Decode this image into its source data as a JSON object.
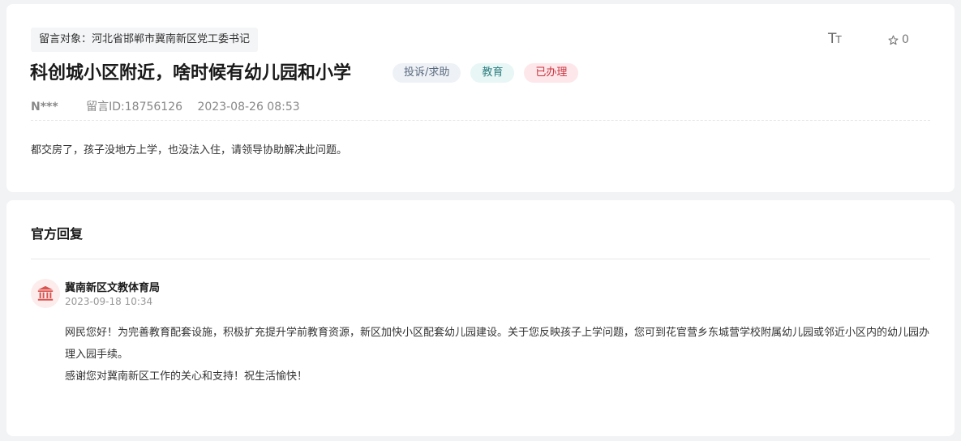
{
  "message": {
    "target": "留言对象：河北省邯郸市冀南新区党工委书记",
    "title": "科创城小区附近，啥时候有幼儿园和小学",
    "tags": [
      "投诉/求助",
      "教育",
      "已办理"
    ],
    "author": "N***",
    "message_id": "留言ID:18756126",
    "datetime": "2023-08-26 08:53",
    "content": "都交房了，孩子没地方上学，也没法入住，请领导协助解决此问题。",
    "font_size_label_big": "T",
    "font_size_label_small": "T",
    "star_count": "0"
  },
  "reply": {
    "heading": "官方回复",
    "org_name": "冀南新区文教体育局",
    "datetime": "2023-09-18 10:34",
    "paragraphs": [
      "网民您好！为完善教育配套设施，积极扩充提升学前教育资源，新区加快小区配套幼儿园建设。关于您反映孩子上学问题，您可到花官营乡东城营学校附属幼儿园或邻近小区内的幼儿园办理入园手续。",
      "感谢您对冀南新区工作的关心和支持！祝生活愉快！"
    ]
  },
  "colors": {
    "page_bg": "#f2f3f5",
    "tag_red": "#c8333e",
    "tag_teal": "#2f7f80",
    "avatar_bg": "#fdecec",
    "avatar_icon": "#d9534f"
  },
  "icons": {
    "font_size": "font-size-icon",
    "star": "star-icon",
    "org": "institution-icon"
  }
}
